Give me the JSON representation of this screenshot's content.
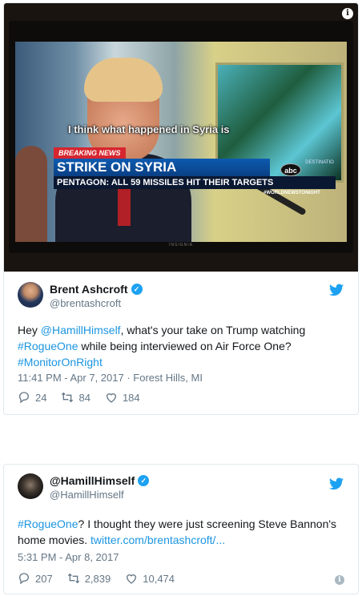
{
  "tweet1": {
    "media": {
      "subtitle": "I think what happened in Syria is",
      "breaking": "BREAKING NEWS",
      "headline": "STRIKE ON SYRIA",
      "subline": "PENTAGON: ALL 59 MISSILES HIT THEIR TARGETS",
      "network": "abc",
      "destination": "DESTINATIO",
      "show_tag": "#WORLDNEWSTONIGHT",
      "brand": "INSIGNIA"
    },
    "author": {
      "name": "Brent Ashcroft",
      "handle": "@brentashcroft"
    },
    "text": {
      "part1": "Hey ",
      "mention": "@HamillHimself",
      "part2": ", what's your take on Trump watching ",
      "hashtag1": "#RogueOne",
      "part3": " while being interviewed on Air Force One?",
      "hashtag2": "#MonitorOnRight"
    },
    "meta": "11:41 PM - Apr 7, 2017 · Forest Hills, MI",
    "replies": "24",
    "retweets": "84",
    "likes": "184"
  },
  "tweet2": {
    "author": {
      "name": "@HamillHimself",
      "handle": "@HamillHimself"
    },
    "text": {
      "hashtag": "#RogueOne",
      "part1": "? I thought they were just screening Steve Bannon's home movies. ",
      "link": "twitter.com/brentashcroft/..."
    },
    "meta": "5:31 PM - Apr 8, 2017",
    "replies": "207",
    "retweets": "2,839",
    "likes": "10,474"
  },
  "colors": {
    "accent": "#1da1f2",
    "link": "#1b95e0",
    "secondary_text": "#657786",
    "border": "#e1e8ed"
  }
}
